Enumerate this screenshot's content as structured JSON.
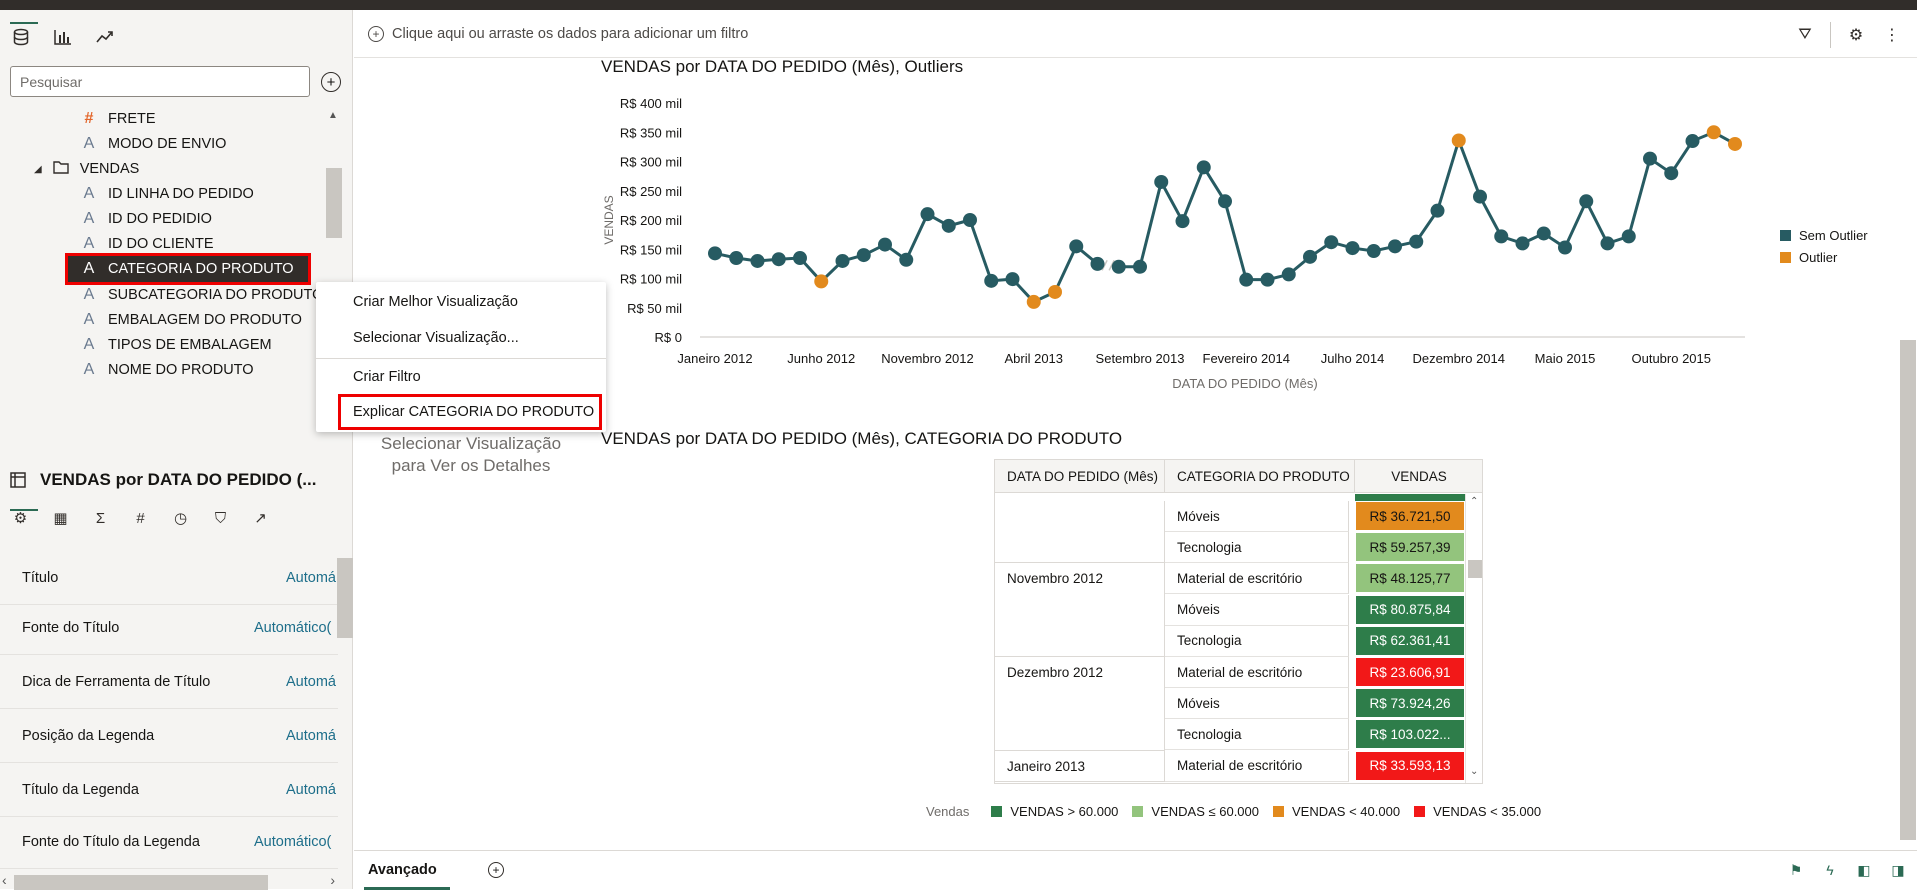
{
  "left_panel": {
    "tabs": [
      "data-icon",
      "visualizations-icon",
      "analytics-icon"
    ],
    "search_placeholder": "Pesquisar",
    "tree": [
      {
        "label": "FRETE",
        "icon": "number"
      },
      {
        "label": "MODO DE ENVIO",
        "icon": "attribute"
      },
      {
        "label": "VENDAS",
        "icon": "folder"
      },
      {
        "label": "ID LINHA DO PEDIDO",
        "icon": "attribute"
      },
      {
        "label": "ID DO PEDIDIO",
        "icon": "attribute"
      },
      {
        "label": "ID DO CLIENTE",
        "icon": "attribute"
      },
      {
        "label": "CATEGORIA DO PRODUTO",
        "icon": "attribute",
        "selected": true
      },
      {
        "label": "SUBCATEGORIA DO PRODUTO",
        "icon": "attribute"
      },
      {
        "label": "EMBALAGEM DO PRODUTO",
        "icon": "attribute"
      },
      {
        "label": "TIPOS DE EMBALAGEM",
        "icon": "attribute"
      },
      {
        "label": "NOME DO PRODUTO",
        "icon": "attribute"
      }
    ],
    "properties_title": "VENDAS por DATA DO PEDIDO (...",
    "properties": [
      {
        "label": "Título",
        "value": "Automá"
      },
      {
        "label": "Fonte do Título",
        "value": "Automático("
      },
      {
        "label": "Dica de Ferramenta de Título",
        "value": "Automá"
      },
      {
        "label": "Posição da Legenda",
        "value": "Automá"
      },
      {
        "label": "Título da Legenda",
        "value": "Automá"
      },
      {
        "label": "Fonte do Título da Legenda",
        "value": "Automático("
      }
    ]
  },
  "filter_bar": {
    "text": "Clique aqui ou arraste os dados para adicionar um filtro"
  },
  "context_menu": {
    "items": [
      "Criar Melhor Visualização",
      "Selecionar Visualização...",
      "Criar Filtro",
      "Explicar CATEGORIA DO PRODUTO"
    ]
  },
  "placeholder": "Selecionar Visualização para Ver os Detalhes",
  "chart1": {
    "title": "VENDAS por DATA DO PEDIDO (Mês), Outliers"
  },
  "chart_data": [
    {
      "type": "line",
      "title": "VENDAS por DATA DO PEDIDO (Mês), Outliers",
      "xlabel": "DATA DO PEDIDO (Mês)",
      "ylabel": "VENDAS",
      "ylim": [
        0,
        400000
      ],
      "yticks": [
        "R$ 0",
        "R$ 50 mil",
        "R$ 100 mil",
        "R$ 150 mil",
        "R$ 200 mil",
        "R$ 250 mil",
        "R$ 300 mil",
        "R$ 350 mil",
        "R$ 400 mil"
      ],
      "xtick_labels": [
        {
          "index": 0,
          "label": "Janeiro 2012"
        },
        {
          "index": 5,
          "label": "Junho 2012"
        },
        {
          "index": 10,
          "label": "Novembro 2012"
        },
        {
          "index": 15,
          "label": "Abril 2013"
        },
        {
          "index": 20,
          "label": "Setembro 2013"
        },
        {
          "index": 25,
          "label": "Fevereiro 2014"
        },
        {
          "index": 30,
          "label": "Julho 2014"
        },
        {
          "index": 35,
          "label": "Dezembro 2014"
        },
        {
          "index": 40,
          "label": "Maio 2015"
        },
        {
          "index": 45,
          "label": "Outubro 2015"
        }
      ],
      "legend": [
        {
          "name": "Sem Outlier",
          "color": "#275b62"
        },
        {
          "name": "Outlier",
          "color": "#e28a1d"
        }
      ],
      "values": [
        143000,
        135000,
        130000,
        133000,
        135000,
        95000,
        130000,
        140000,
        158000,
        132000,
        210000,
        190000,
        200000,
        96000,
        99000,
        60000,
        77000,
        155000,
        125000,
        120000,
        120000,
        265000,
        198000,
        290000,
        232000,
        98000,
        98000,
        107000,
        137000,
        162000,
        152000,
        147000,
        155000,
        163000,
        216000,
        336000,
        240000,
        172000,
        160000,
        177000,
        153000,
        232000,
        160000,
        172000,
        305000,
        280000,
        335000,
        350000,
        330000
      ],
      "outlier_indices": [
        5,
        15,
        16,
        35,
        47,
        48
      ],
      "gap_after_index": 18
    },
    {
      "type": "table",
      "title": "VENDAS por DATA DO PEDIDO (Mês), CATEGORIA DO PRODUTO",
      "columns": [
        "DATA DO PEDIDO (Mês)",
        "CATEGORIA DO PRODUTO",
        "VENDAS"
      ],
      "groups": [
        {
          "date": "",
          "rows": [
            {
              "category": "Móveis",
              "value": "R$ 36.721,50",
              "color": "#e28a1d"
            },
            {
              "category": "Tecnologia",
              "value": "R$ 59.257,39",
              "color": "#93c47d"
            }
          ]
        },
        {
          "date": "Novembro 2012",
          "rows": [
            {
              "category": "Material de escritório",
              "value": "R$ 48.125,77",
              "color": "#93c47d"
            },
            {
              "category": "Móveis",
              "value": "R$ 80.875,84",
              "color": "#2e7d4a"
            },
            {
              "category": "Tecnologia",
              "value": "R$ 62.361,41",
              "color": "#2e7d4a"
            }
          ]
        },
        {
          "date": "Dezembro 2012",
          "rows": [
            {
              "category": "Material de escritório",
              "value": "R$ 23.606,91",
              "color": "#f21818"
            },
            {
              "category": "Móveis",
              "value": "R$ 73.924,26",
              "color": "#2e7d4a"
            },
            {
              "category": "Tecnologia",
              "value": "R$ 103.022...",
              "color": "#2e7d4a"
            }
          ]
        },
        {
          "date": "Janeiro 2013",
          "rows": [
            {
              "category": "Material de escritório",
              "value": "R$ 33.593,13",
              "color": "#f21818"
            }
          ]
        }
      ],
      "legend_title": "Vendas",
      "legend": [
        {
          "name": "VENDAS > 60.000",
          "color": "#2e7d4a"
        },
        {
          "name": "VENDAS ≤ 60.000",
          "color": "#93c47d"
        },
        {
          "name": "VENDAS < 40.000",
          "color": "#e28a1d"
        },
        {
          "name": "VENDAS < 35.000",
          "color": "#f21818"
        }
      ]
    }
  ],
  "bottom_bar": {
    "tab": "Avançado"
  }
}
